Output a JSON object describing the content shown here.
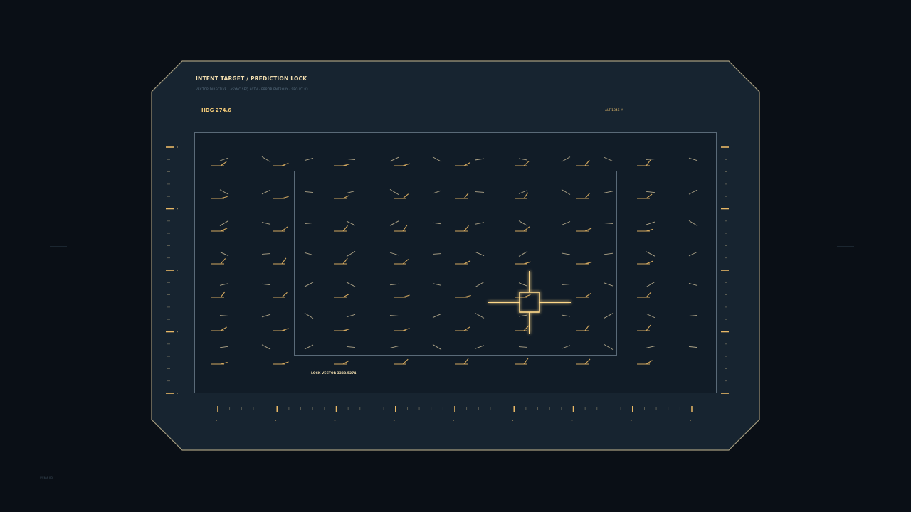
{
  "header": {
    "title": "INTENT TARGET / PREDICTION LOCK",
    "subtitle": "VECTOR.DIRECTIVE · ASYNC.SEQ ACTV · ERROR.ENTROPY · SEQ RT 83"
  },
  "readouts": {
    "heading": "HDG 274.6",
    "altitude": "ALT 1846 M",
    "lock_vector": "LOCK VECTOR 3333.5274",
    "footer": "VXM4.0B"
  },
  "colors": {
    "background": "#0a0f16",
    "panel": "#172430",
    "panel_border": "#a39a7d",
    "accent": "#e8b866",
    "accent_bright": "#ffd98a"
  },
  "target": {
    "grid_col": 5,
    "grid_row": 4
  }
}
